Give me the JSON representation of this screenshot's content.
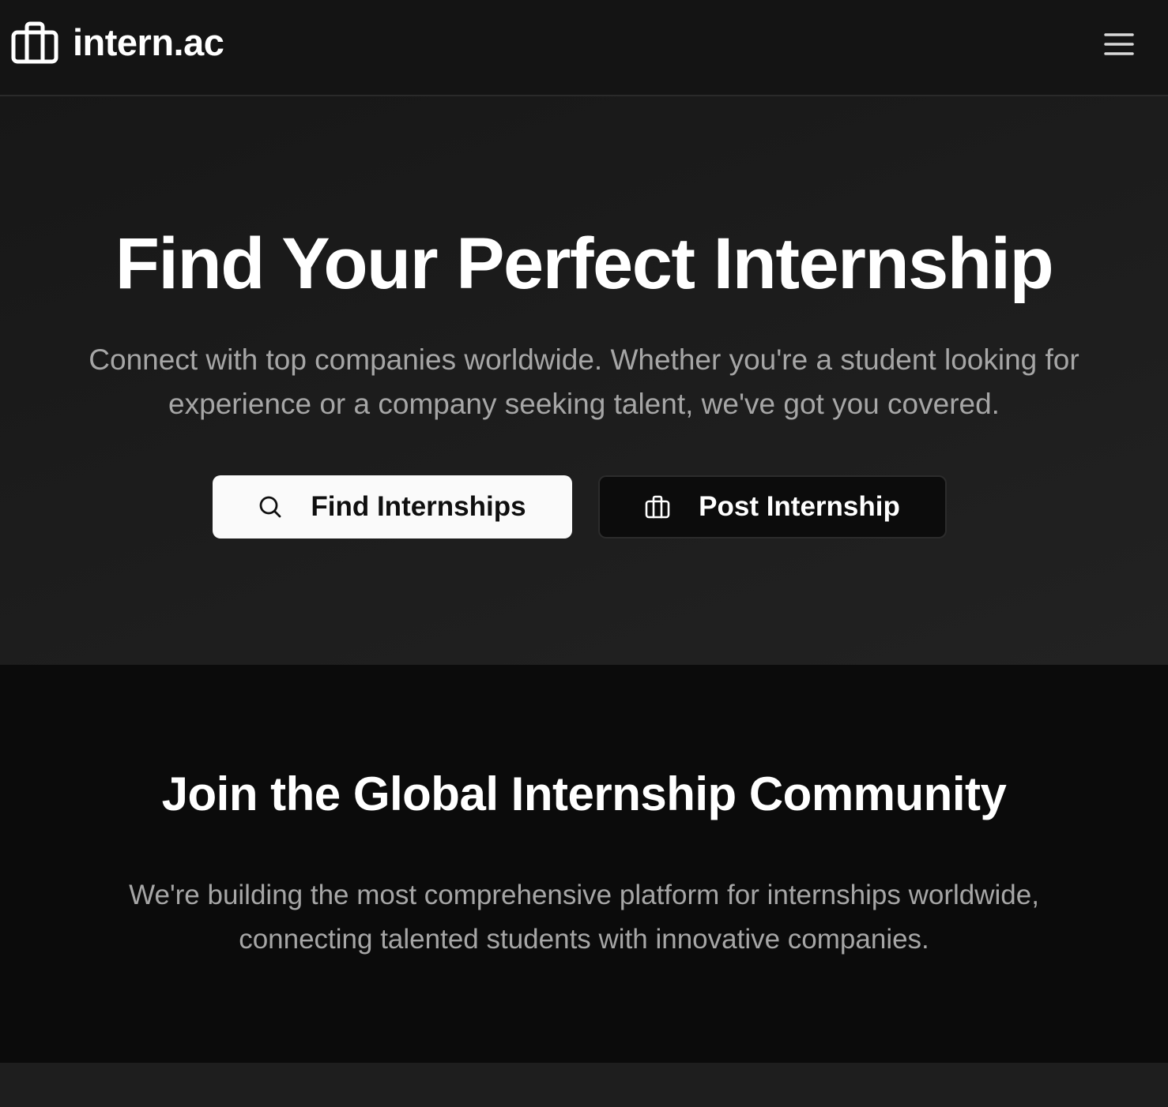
{
  "header": {
    "logo_text": "intern.ac",
    "logo_icon": "briefcase-icon",
    "menu_icon": "hamburger-menu-icon"
  },
  "hero": {
    "title": "Find Your Perfect Internship",
    "subtitle": "Connect with top companies worldwide. Whether you're a student looking for experience or a company seeking talent, we've got you covered.",
    "primary_button": {
      "label": "Find Internships",
      "icon": "search-icon"
    },
    "secondary_button": {
      "label": "Post Internship",
      "icon": "briefcase-icon"
    }
  },
  "community": {
    "title": "Join the Global Internship Community",
    "text": "We're building the most comprehensive platform for internships worldwide, connecting talented students with innovative companies."
  },
  "colors": {
    "header_bg": "#141414",
    "hero_bg": "#1c1c1c",
    "community_bg": "#0b0b0b",
    "primary_button_bg": "#fafafa",
    "secondary_button_bg": "#0c0c0c",
    "muted_text": "#a6a6a6"
  }
}
